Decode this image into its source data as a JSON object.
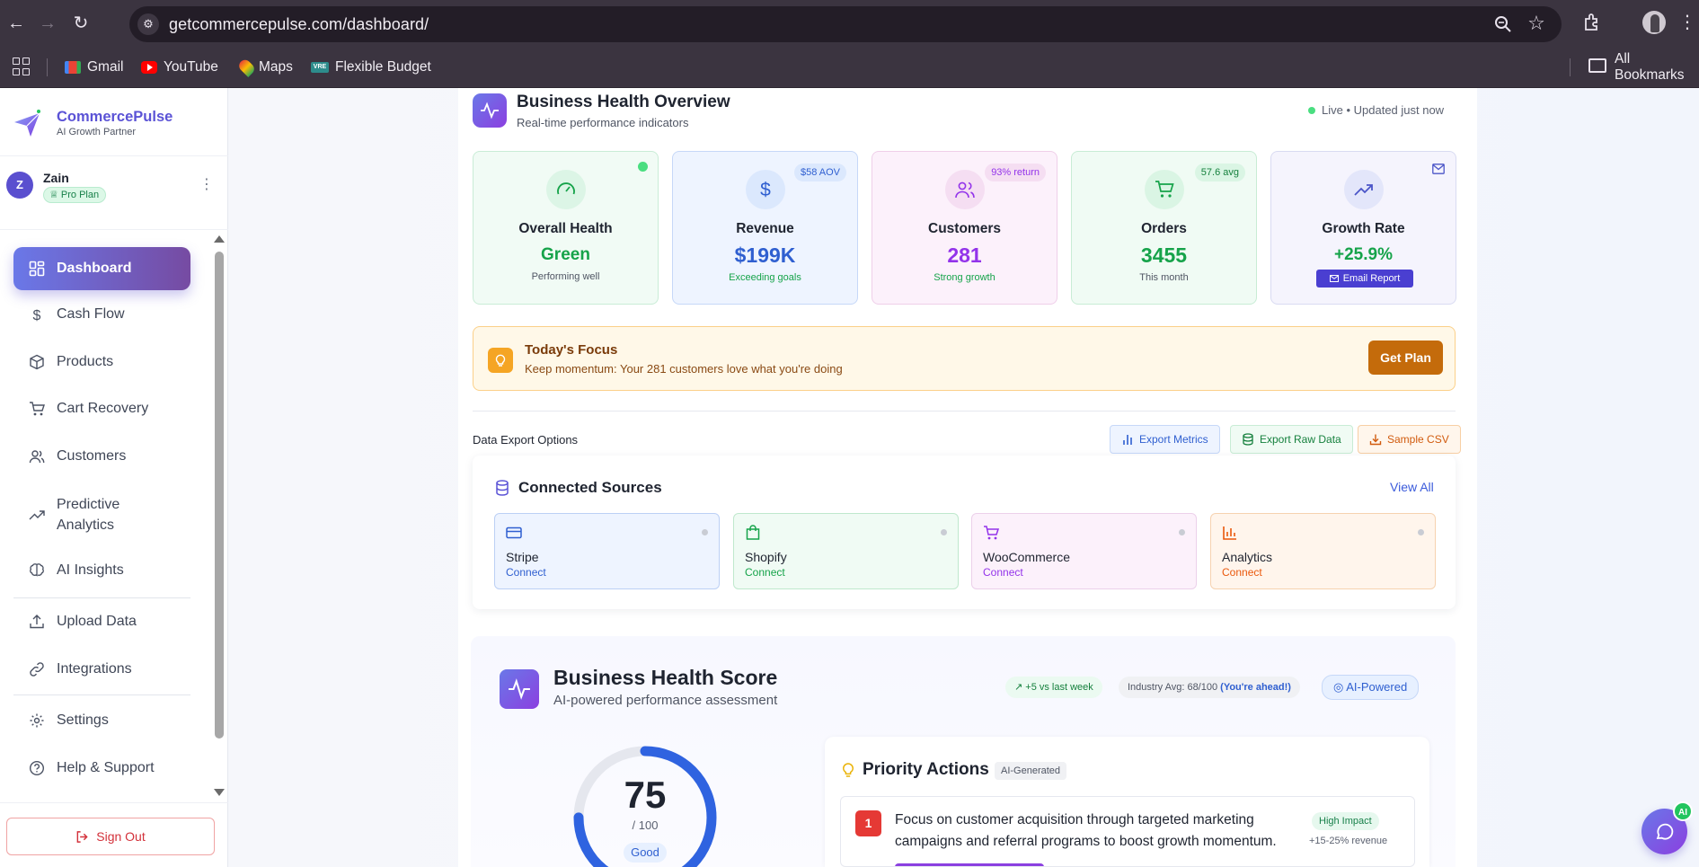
{
  "browser": {
    "url": "getcommercepulse.com/dashboard/",
    "bookmarks": [
      "Gmail",
      "YouTube",
      "Maps",
      "Flexible Budget"
    ],
    "bookmarks_right": "All Bookmarks"
  },
  "sidebar": {
    "brand": "CommercePulse",
    "tagline": "AI Growth Partner",
    "user": {
      "initial": "Z",
      "name": "Zain",
      "plan": "Pro Plan"
    },
    "nav": [
      {
        "label": "Dashboard",
        "icon": "dashboard-icon",
        "active": true
      },
      {
        "label": "Cash Flow",
        "icon": "dollar-icon"
      },
      {
        "label": "Products",
        "icon": "box-icon"
      },
      {
        "label": "Cart Recovery",
        "icon": "cart-icon"
      },
      {
        "label": "Customers",
        "icon": "users-icon"
      },
      {
        "label": "Predictive Analytics",
        "icon": "trend-icon"
      },
      {
        "label": "AI Insights",
        "icon": "brain-icon"
      },
      {
        "label": "Upload Data",
        "icon": "upload-icon"
      },
      {
        "label": "Integrations",
        "icon": "link-icon"
      },
      {
        "label": "Settings",
        "icon": "gear-icon"
      },
      {
        "label": "Help & Support",
        "icon": "help-icon"
      }
    ],
    "sign_out": "Sign Out"
  },
  "overview": {
    "title": "Business Health Overview",
    "subtitle": "Real-time performance indicators",
    "live": "Live • Updated just now",
    "kpis": [
      {
        "label": "Overall Health",
        "value": "Green",
        "sub": "Performing well",
        "badge": ""
      },
      {
        "label": "Revenue",
        "value": "$199K",
        "sub": "Exceeding goals",
        "badge": "$58 AOV"
      },
      {
        "label": "Customers",
        "value": "281",
        "sub": "Strong growth",
        "badge": "93% return"
      },
      {
        "label": "Orders",
        "value": "3455",
        "sub": "This month",
        "badge": "57.6 avg"
      },
      {
        "label": "Growth Rate",
        "value": "+25.9%",
        "sub": "",
        "badge": "",
        "button": "Email Report"
      }
    ]
  },
  "focus": {
    "title": "Today's Focus",
    "text": "Keep momentum: Your 281 customers love what you're doing",
    "button": "Get Plan"
  },
  "export": {
    "label": "Data Export Options",
    "buttons": [
      "Export Metrics",
      "Export Raw Data",
      "Sample CSV"
    ]
  },
  "sources": {
    "title": "Connected Sources",
    "view_all": "View All",
    "items": [
      {
        "name": "Stripe",
        "action": "Connect"
      },
      {
        "name": "Shopify",
        "action": "Connect"
      },
      {
        "name": "WooCommerce",
        "action": "Connect"
      },
      {
        "name": "Analytics",
        "action": "Connect"
      }
    ]
  },
  "score": {
    "title": "Business Health Score",
    "subtitle": "AI-powered performance assessment",
    "chip_week": "+5 vs last week",
    "chip_industry": "Industry Avg: 68/100",
    "chip_ahead": "(You're ahead!)",
    "chip_ai": "AI-Powered",
    "value": 75,
    "max": "/ 100",
    "rating": "Good"
  },
  "priority": {
    "title": "Priority Actions",
    "badge": "AI-Generated",
    "items": [
      {
        "num": "1",
        "text": "Focus on customer acquisition through targeted marketing campaigns and referral programs to boost growth momentum.",
        "impact": "High Impact",
        "revenue": "+15-25% revenue"
      }
    ]
  },
  "chat": {
    "badge": "AI"
  },
  "colors": {
    "brand": "#5b53d6",
    "green": "#16a34a",
    "blue": "#2f5fd0",
    "purple": "#9333ea",
    "orange": "#c46b0b"
  }
}
